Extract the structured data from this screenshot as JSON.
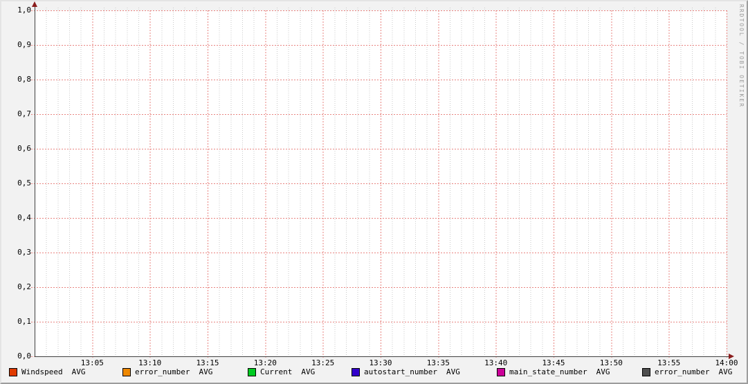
{
  "watermark": "RRDTOOL / TOBI OETIKER",
  "chart_data": {
    "type": "line",
    "title": "",
    "xlabel": "",
    "ylabel": "",
    "x_ticks": [
      "13:05",
      "13:10",
      "13:15",
      "13:20",
      "13:25",
      "13:30",
      "13:35",
      "13:40",
      "13:45",
      "13:50",
      "13:55",
      "14:00"
    ],
    "y_ticks": [
      "1,0",
      "0,9",
      "0,8",
      "0,7",
      "0,6",
      "0,5",
      "0,4",
      "0,3",
      "0,2",
      "0,1",
      "0,0"
    ],
    "ylim": [
      0.0,
      1.0
    ],
    "x_minor_per_major": 5,
    "grid": true,
    "legend_position": "bottom",
    "series": [
      {
        "name": "Windspeed",
        "stat": "AVG",
        "color": "#E03A00",
        "values": []
      },
      {
        "name": "error_number",
        "stat": "AVG",
        "color": "#EE8800",
        "values": []
      },
      {
        "name": "Current",
        "stat": "AVG",
        "color": "#00CC22",
        "values": []
      },
      {
        "name": "autostart_number",
        "stat": "AVG",
        "color": "#3300CC",
        "values": []
      },
      {
        "name": "main_state_number",
        "stat": "AVG",
        "color": "#CC0099",
        "values": []
      },
      {
        "name": "error_number",
        "stat": "AVG",
        "color": "#4F4F4F",
        "values": []
      }
    ]
  },
  "colors": {
    "background": "#F2F2F2",
    "canvas": "#FFFFFF",
    "axis": "#3F3F3F",
    "arrow": "#8B1E1E",
    "major_grid": "#E8837F",
    "minor_grid": "#C9C9C9",
    "watermark": "#9A9A9A"
  }
}
